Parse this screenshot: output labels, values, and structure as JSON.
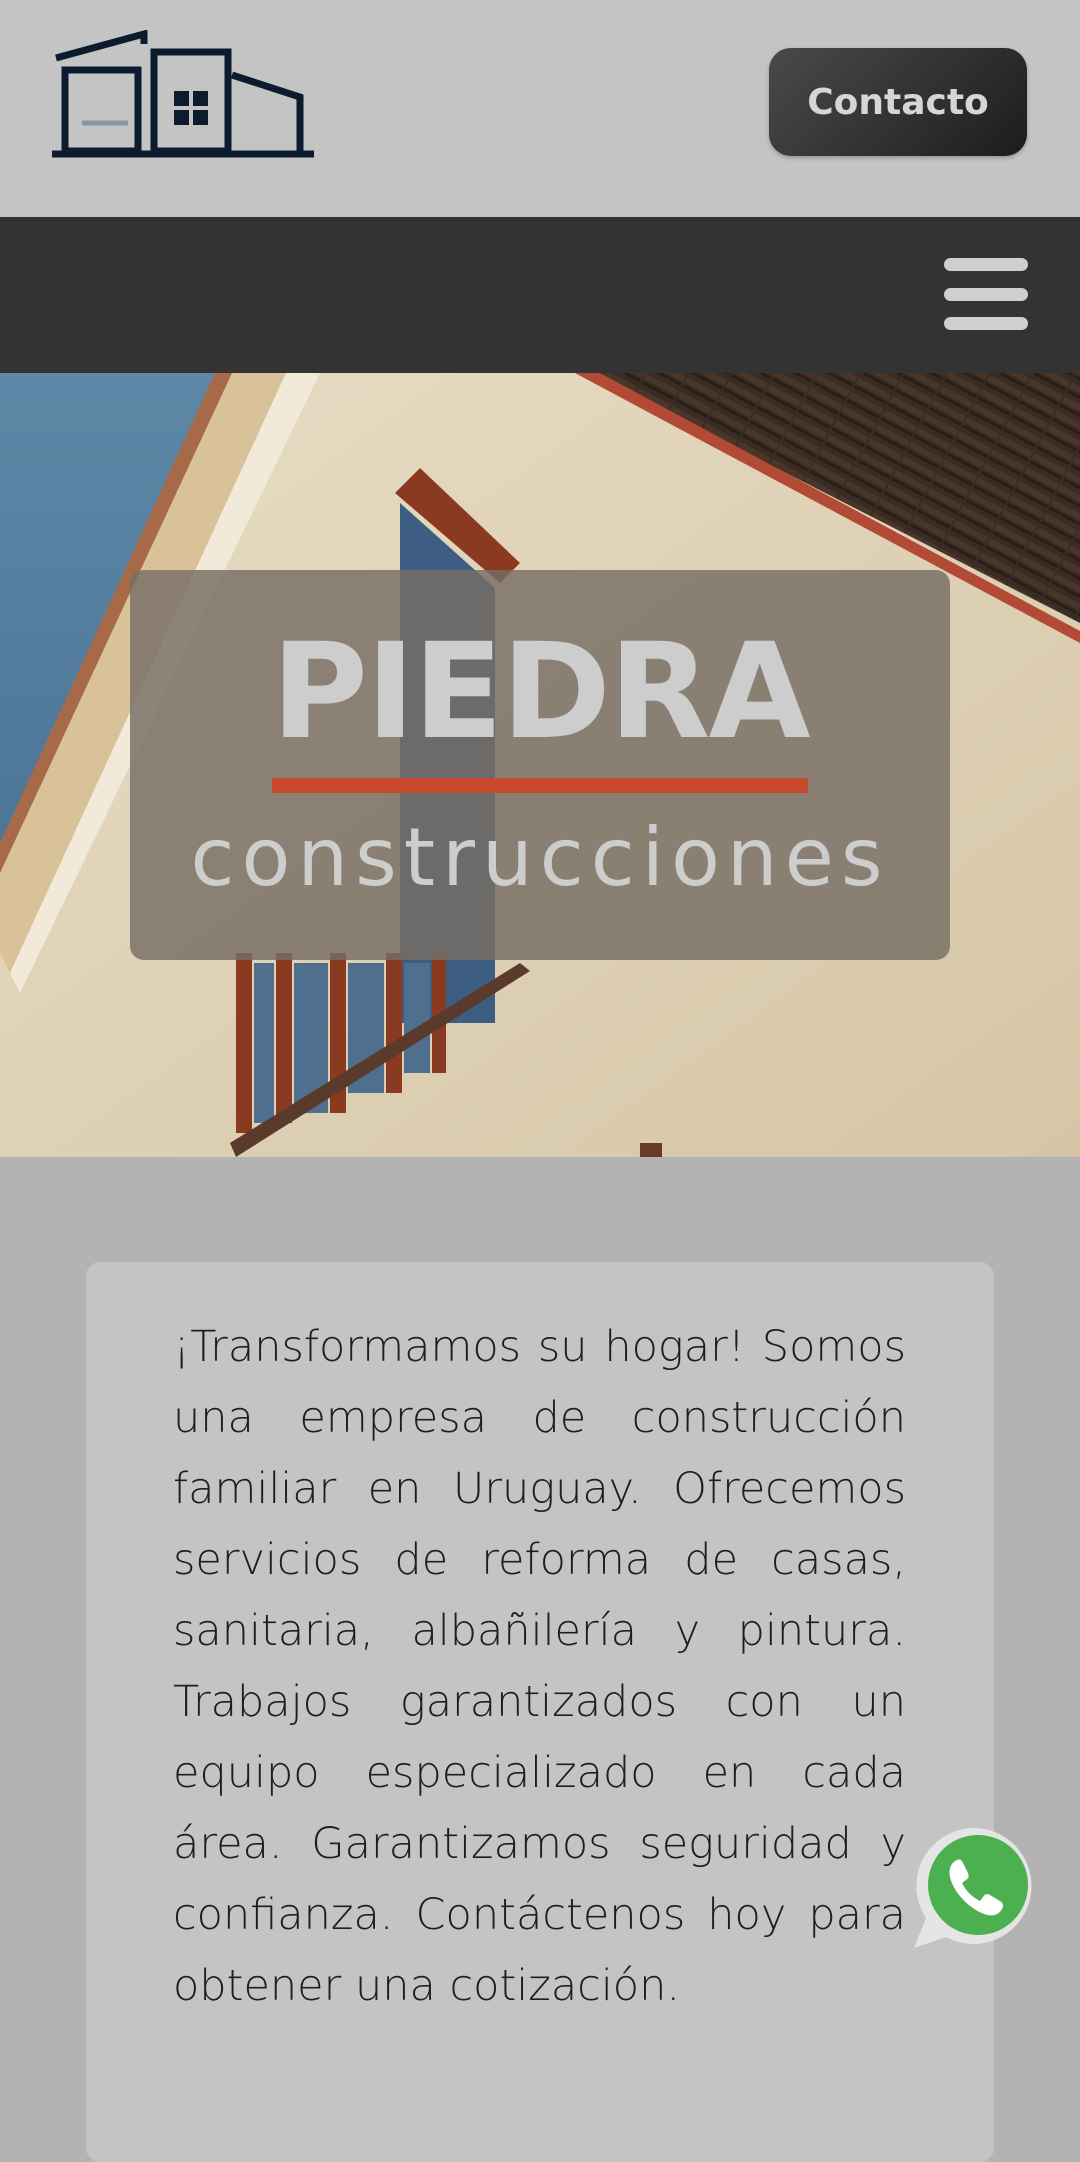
{
  "header": {
    "logo_icon": "house-logo-icon",
    "contact_label": "Contacto"
  },
  "nav": {
    "menu_icon": "hamburger-menu-icon"
  },
  "hero": {
    "title": "PIEDRA",
    "subtitle": "construcciones",
    "accent_color": "#c84a2c"
  },
  "about": {
    "text": "¡Transformamos su hogar! Somos una empresa de construcción familiar en Uruguay. Ofrecemos servicios de reforma de casas, sanitaria, albañilería y pintura. Trabajos garantizados con un equipo especializado en cada área. Garantizamos seguridad y confianza. Contáctenos hoy para obtener una cotización."
  },
  "floating": {
    "whatsapp_icon": "whatsapp-icon",
    "whatsapp_color": "#4caf50"
  },
  "colors": {
    "topbar_bg": "#c4c4c4",
    "navbar_bg": "#333333",
    "page_bg": "#b3b3b3",
    "logo_color": "#0d1b2e"
  }
}
